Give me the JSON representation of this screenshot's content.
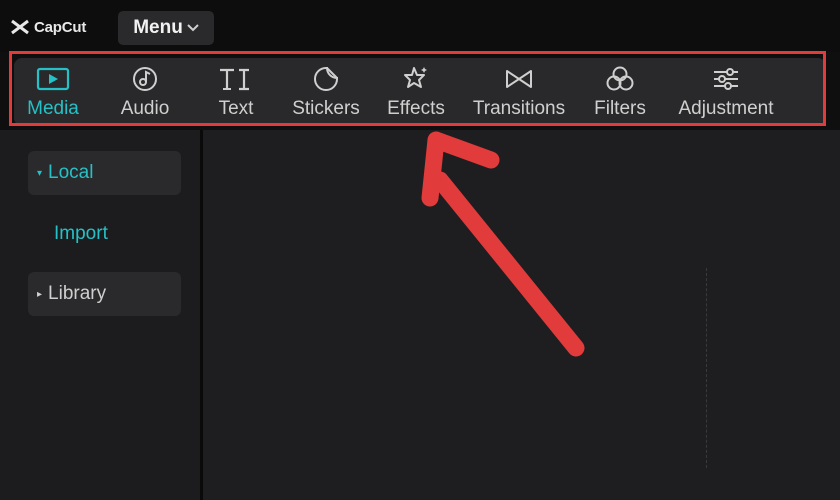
{
  "app": {
    "logo_text": "CapCut"
  },
  "menu": {
    "label": "Menu"
  },
  "toolbar": {
    "tabs": [
      {
        "label": "Media",
        "icon": "media-icon",
        "active": true
      },
      {
        "label": "Audio",
        "icon": "audio-icon",
        "active": false
      },
      {
        "label": "Text",
        "icon": "text-icon",
        "active": false
      },
      {
        "label": "Stickers",
        "icon": "stickers-icon",
        "active": false
      },
      {
        "label": "Effects",
        "icon": "effects-icon",
        "active": false
      },
      {
        "label": "Transitions",
        "icon": "transitions-icon",
        "active": false
      },
      {
        "label": "Filters",
        "icon": "filters-icon",
        "active": false
      },
      {
        "label": "Adjustment",
        "icon": "adjustment-icon",
        "active": false
      }
    ]
  },
  "sidebar": {
    "local": {
      "label": "Local",
      "expanded": true
    },
    "import": {
      "label": "Import"
    },
    "library": {
      "label": "Library",
      "expanded": false
    }
  },
  "annotation": {
    "color": "#e23b3b",
    "icon": "arrow-icon"
  },
  "colors": {
    "accent": "#25c1c6",
    "text": "#cfcfcf",
    "panel": "#29292b"
  }
}
